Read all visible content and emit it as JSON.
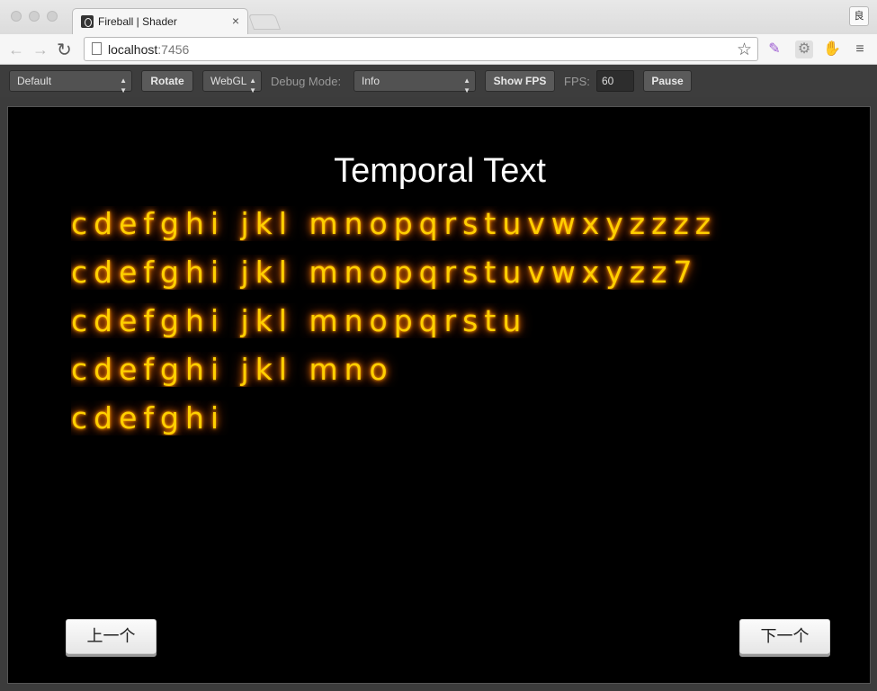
{
  "browser": {
    "tab_title": "Fireball | Shader",
    "tab_close": "×",
    "url_host": "localhost",
    "url_port": ":7456",
    "profile_label": "良"
  },
  "toolbar": {
    "scene_select": "Default",
    "rotate_label": "Rotate",
    "renderer_select": "WebGL",
    "debug_mode_label": "Debug Mode:",
    "debug_mode_select": "Info",
    "show_fps_label": "Show FPS",
    "fps_label": "FPS:",
    "fps_value": "60",
    "pause_label": "Pause"
  },
  "canvas": {
    "title": "Temporal Text",
    "lines": [
      "cdefghi jkl mnopqrstuvwxyzzzz",
      "cdefghi jkl mnopqrstuvwxyzz7",
      "cdefghi jkl mnopqrstu",
      "cdefghi jkl mno",
      "cdefghi"
    ],
    "prev_label": "上一个",
    "next_label": "下一个"
  },
  "colors": {
    "glow_text": "#ffd000",
    "glow_halo": "#ff7a00",
    "canvas_bg": "#000000"
  },
  "icons": [
    "back-arrow-icon",
    "forward-arrow-icon",
    "reload-icon",
    "page-icon",
    "star-icon",
    "feather-icon",
    "extension-icon",
    "evernote-icon",
    "menu-icon"
  ]
}
